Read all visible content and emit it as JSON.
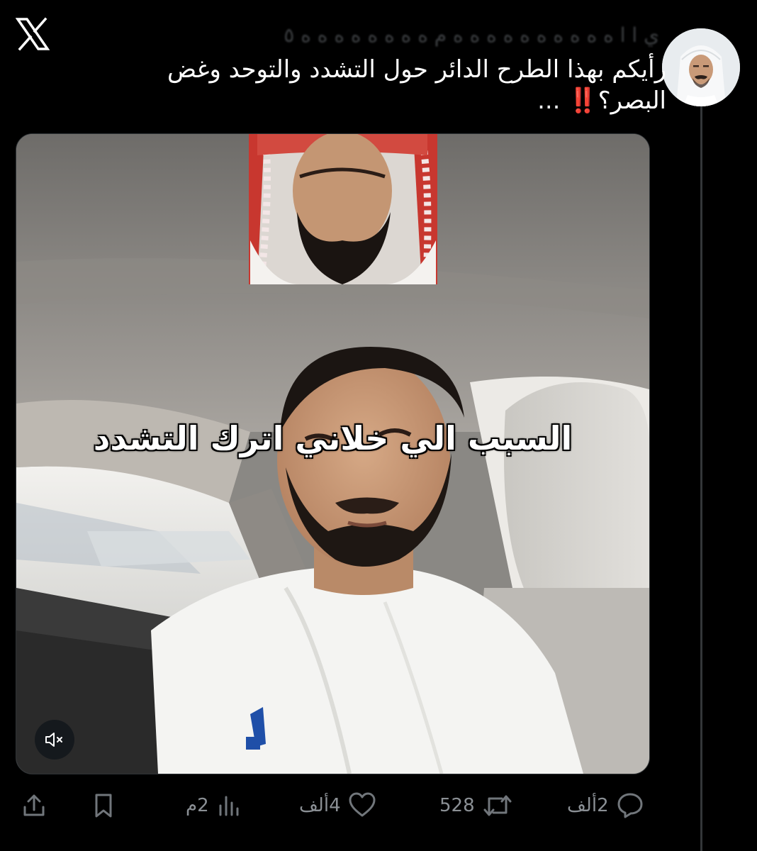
{
  "brand": {
    "logo_icon": "x-logo-icon"
  },
  "tweet": {
    "author_name_obscured": "ي ا ا ه ه ه ه ه ه ه ه ه ه م ه ه ه ه ه ه ه ه ٥",
    "text_main": "رأيكم بهذا الطرح الدائر حول التشدد والتوحد وغض البصر؟",
    "text_emoji": "‼️",
    "text_ellipsis": " ..."
  },
  "media": {
    "caption": "السبب الي خلاني اترك التشدد",
    "mute_icon": "speaker-muted-icon"
  },
  "actions": {
    "reply": {
      "icon": "reply-icon",
      "count": "2ألف"
    },
    "retweet": {
      "icon": "retweet-icon",
      "count": "528"
    },
    "like": {
      "icon": "heart-icon",
      "count": "4ألف"
    },
    "views": {
      "icon": "views-chart-icon",
      "count": "2م"
    },
    "bookmark": {
      "icon": "bookmark-icon"
    },
    "share": {
      "icon": "share-icon"
    }
  },
  "colors": {
    "background": "#000000",
    "text_primary": "#ffffff",
    "text_secondary": "#71767b",
    "divider": "#333639",
    "emoji_red": "#f91880"
  }
}
